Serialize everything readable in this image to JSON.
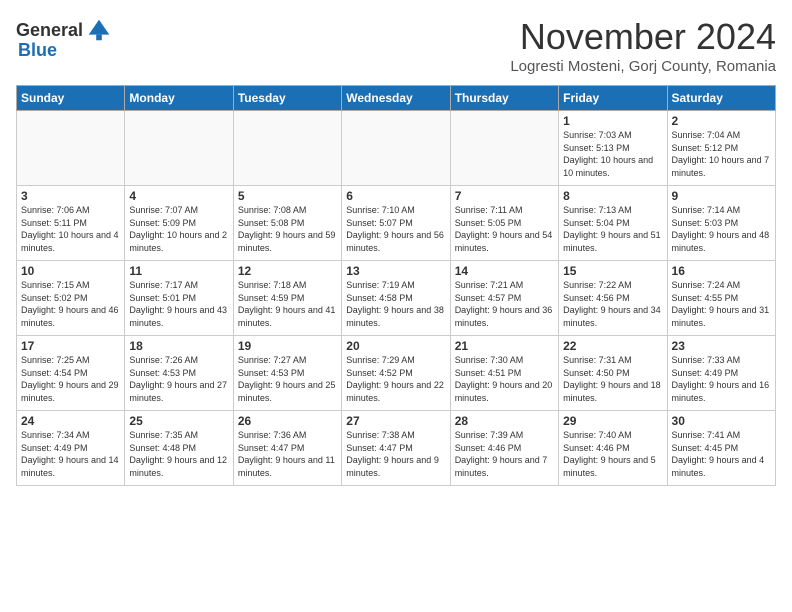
{
  "header": {
    "logo_general": "General",
    "logo_blue": "Blue",
    "month_title": "November 2024",
    "location": "Logresti Mosteni, Gorj County, Romania"
  },
  "days_of_week": [
    "Sunday",
    "Monday",
    "Tuesday",
    "Wednesday",
    "Thursday",
    "Friday",
    "Saturday"
  ],
  "weeks": [
    [
      {
        "day": "",
        "info": ""
      },
      {
        "day": "",
        "info": ""
      },
      {
        "day": "",
        "info": ""
      },
      {
        "day": "",
        "info": ""
      },
      {
        "day": "",
        "info": ""
      },
      {
        "day": "1",
        "info": "Sunrise: 7:03 AM\nSunset: 5:13 PM\nDaylight: 10 hours and 10 minutes."
      },
      {
        "day": "2",
        "info": "Sunrise: 7:04 AM\nSunset: 5:12 PM\nDaylight: 10 hours and 7 minutes."
      }
    ],
    [
      {
        "day": "3",
        "info": "Sunrise: 7:06 AM\nSunset: 5:11 PM\nDaylight: 10 hours and 4 minutes."
      },
      {
        "day": "4",
        "info": "Sunrise: 7:07 AM\nSunset: 5:09 PM\nDaylight: 10 hours and 2 minutes."
      },
      {
        "day": "5",
        "info": "Sunrise: 7:08 AM\nSunset: 5:08 PM\nDaylight: 9 hours and 59 minutes."
      },
      {
        "day": "6",
        "info": "Sunrise: 7:10 AM\nSunset: 5:07 PM\nDaylight: 9 hours and 56 minutes."
      },
      {
        "day": "7",
        "info": "Sunrise: 7:11 AM\nSunset: 5:05 PM\nDaylight: 9 hours and 54 minutes."
      },
      {
        "day": "8",
        "info": "Sunrise: 7:13 AM\nSunset: 5:04 PM\nDaylight: 9 hours and 51 minutes."
      },
      {
        "day": "9",
        "info": "Sunrise: 7:14 AM\nSunset: 5:03 PM\nDaylight: 9 hours and 48 minutes."
      }
    ],
    [
      {
        "day": "10",
        "info": "Sunrise: 7:15 AM\nSunset: 5:02 PM\nDaylight: 9 hours and 46 minutes."
      },
      {
        "day": "11",
        "info": "Sunrise: 7:17 AM\nSunset: 5:01 PM\nDaylight: 9 hours and 43 minutes."
      },
      {
        "day": "12",
        "info": "Sunrise: 7:18 AM\nSunset: 4:59 PM\nDaylight: 9 hours and 41 minutes."
      },
      {
        "day": "13",
        "info": "Sunrise: 7:19 AM\nSunset: 4:58 PM\nDaylight: 9 hours and 38 minutes."
      },
      {
        "day": "14",
        "info": "Sunrise: 7:21 AM\nSunset: 4:57 PM\nDaylight: 9 hours and 36 minutes."
      },
      {
        "day": "15",
        "info": "Sunrise: 7:22 AM\nSunset: 4:56 PM\nDaylight: 9 hours and 34 minutes."
      },
      {
        "day": "16",
        "info": "Sunrise: 7:24 AM\nSunset: 4:55 PM\nDaylight: 9 hours and 31 minutes."
      }
    ],
    [
      {
        "day": "17",
        "info": "Sunrise: 7:25 AM\nSunset: 4:54 PM\nDaylight: 9 hours and 29 minutes."
      },
      {
        "day": "18",
        "info": "Sunrise: 7:26 AM\nSunset: 4:53 PM\nDaylight: 9 hours and 27 minutes."
      },
      {
        "day": "19",
        "info": "Sunrise: 7:27 AM\nSunset: 4:53 PM\nDaylight: 9 hours and 25 minutes."
      },
      {
        "day": "20",
        "info": "Sunrise: 7:29 AM\nSunset: 4:52 PM\nDaylight: 9 hours and 22 minutes."
      },
      {
        "day": "21",
        "info": "Sunrise: 7:30 AM\nSunset: 4:51 PM\nDaylight: 9 hours and 20 minutes."
      },
      {
        "day": "22",
        "info": "Sunrise: 7:31 AM\nSunset: 4:50 PM\nDaylight: 9 hours and 18 minutes."
      },
      {
        "day": "23",
        "info": "Sunrise: 7:33 AM\nSunset: 4:49 PM\nDaylight: 9 hours and 16 minutes."
      }
    ],
    [
      {
        "day": "24",
        "info": "Sunrise: 7:34 AM\nSunset: 4:49 PM\nDaylight: 9 hours and 14 minutes."
      },
      {
        "day": "25",
        "info": "Sunrise: 7:35 AM\nSunset: 4:48 PM\nDaylight: 9 hours and 12 minutes."
      },
      {
        "day": "26",
        "info": "Sunrise: 7:36 AM\nSunset: 4:47 PM\nDaylight: 9 hours and 11 minutes."
      },
      {
        "day": "27",
        "info": "Sunrise: 7:38 AM\nSunset: 4:47 PM\nDaylight: 9 hours and 9 minutes."
      },
      {
        "day": "28",
        "info": "Sunrise: 7:39 AM\nSunset: 4:46 PM\nDaylight: 9 hours and 7 minutes."
      },
      {
        "day": "29",
        "info": "Sunrise: 7:40 AM\nSunset: 4:46 PM\nDaylight: 9 hours and 5 minutes."
      },
      {
        "day": "30",
        "info": "Sunrise: 7:41 AM\nSunset: 4:45 PM\nDaylight: 9 hours and 4 minutes."
      }
    ]
  ]
}
